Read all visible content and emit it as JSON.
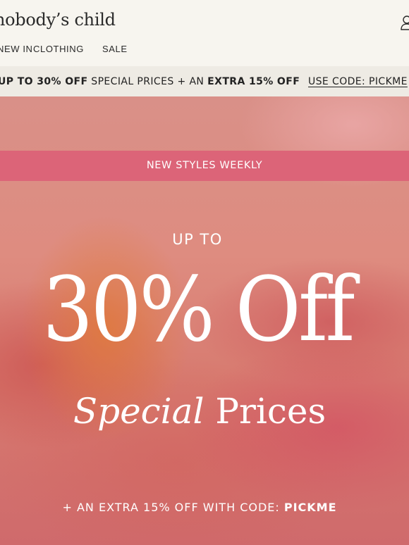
{
  "header": {
    "logo_text": "nobody’s child",
    "account_icon": "account-icon",
    "nav": [
      {
        "label": "NEW IN"
      },
      {
        "label": "CLOTHING"
      },
      {
        "label": "SALE"
      }
    ]
  },
  "promo_bar": {
    "bold_1": "UP TO 30% OFF",
    "text_1": " SPECIAL PRICES + AN ",
    "bold_2": "EXTRA 15% OFF",
    "code_link": "USE CODE: PICKME"
  },
  "hero": {
    "banner": "NEW STYLES WEEKLY",
    "upto": "UP TO",
    "headline": "30% Off",
    "subhead_italic": "Special",
    "subhead_rest": " Prices",
    "extra_text": "+ AN EXTRA 15% OFF WITH CODE: ",
    "extra_code": "PICKME",
    "banner_color": "#dc6478"
  }
}
